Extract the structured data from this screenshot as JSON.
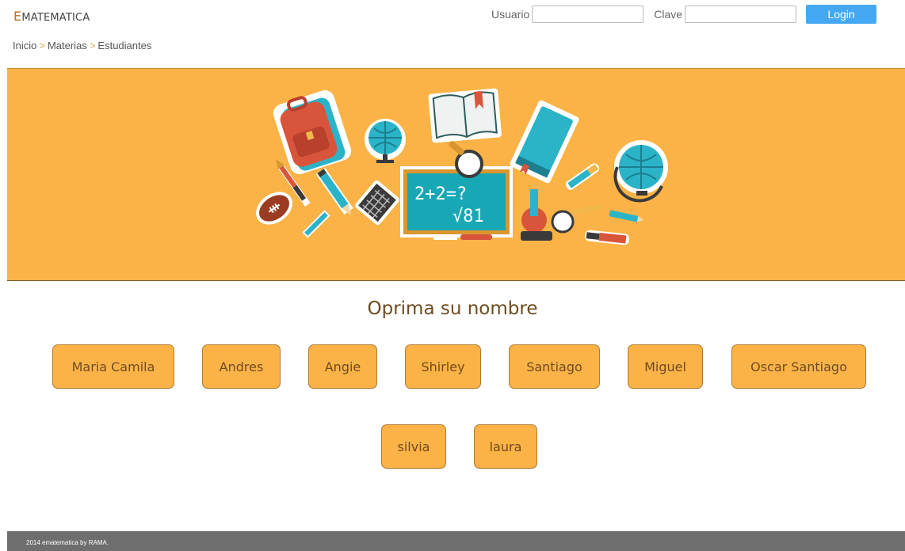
{
  "header": {
    "logo_first": "E",
    "logo_rest": "MATEMATICA",
    "user_label": "Usuario",
    "user_value": "",
    "pass_label": "Clave",
    "pass_value": "",
    "login_button": "Login"
  },
  "breadcrumb": {
    "items": [
      "Inicio",
      "Materias",
      "Estudiantes"
    ],
    "separator": ">"
  },
  "banner": {
    "chalkboard_line1": "2+2=?",
    "chalkboard_line2": "√81"
  },
  "main": {
    "prompt": "Oprima su nombre",
    "students": [
      "Maria Camila",
      "Andres",
      "Angie",
      "Shirley",
      "Santiago",
      "Miguel",
      "Oscar Santiago",
      "silvia",
      "laura"
    ]
  },
  "footer": {
    "text": "2014 ematematica by RAMA."
  },
  "colors": {
    "accent_orange": "#fbb347",
    "button_text": "#6f4b1f",
    "login_blue": "#44a9f2",
    "footer_gray": "#6e6e6e"
  }
}
